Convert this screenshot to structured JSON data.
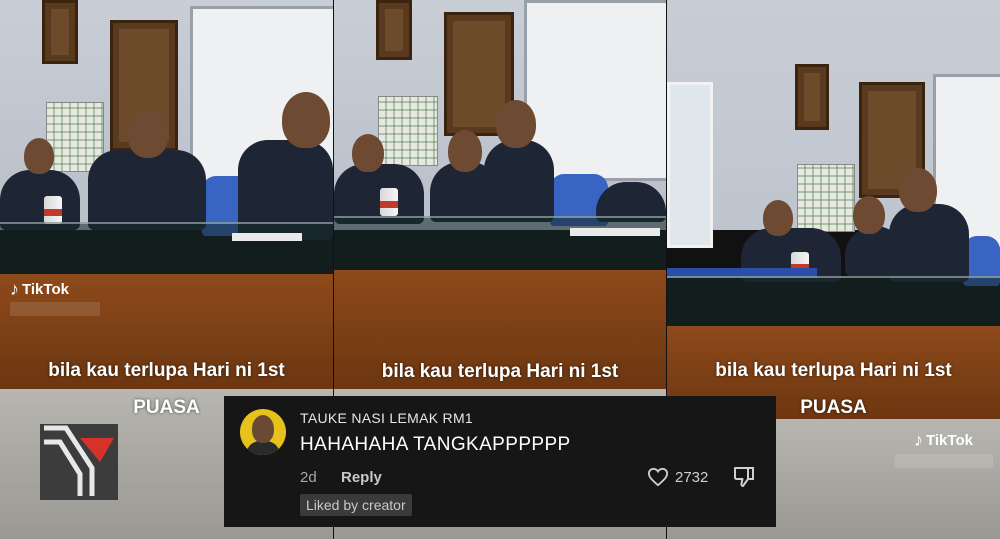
{
  "panels": [
    {
      "caption_line1": "bila kau terlupa Hari ni 1st",
      "caption_line2": "PUASA",
      "watermark": "TikTok"
    },
    {
      "caption_line1": "bila kau terlupa Hari ni 1st"
    },
    {
      "caption_line1": "bila kau terlupa Hari ni 1st",
      "caption_line2": "PUASA",
      "watermark": "TikTok"
    }
  ],
  "comment": {
    "username": "TAUKE NASI LEMAK RM1",
    "text": "HAHAHAHA TANGKAPPPPPP",
    "age": "2d",
    "reply_label": "Reply",
    "like_count": "2732",
    "badge": "Liked by creator",
    "icons": {
      "like": "heart-outline-icon",
      "dislike": "thumbs-down-icon"
    }
  },
  "colors": {
    "comment_bg": "#161616",
    "logo_red": "#d6322a",
    "chair_blue": "#3a64c2"
  }
}
